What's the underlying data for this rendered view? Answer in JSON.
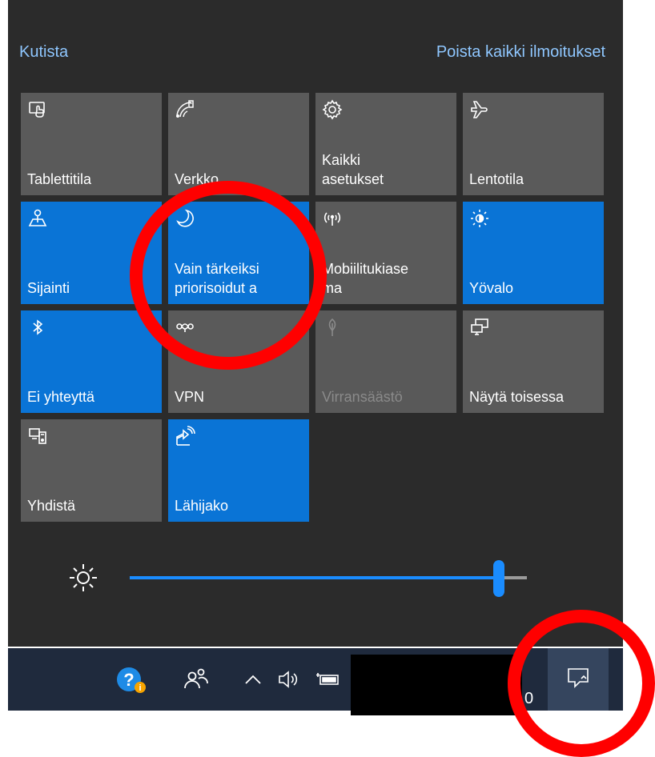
{
  "header": {
    "collapse": "Kutista",
    "clear_all": "Poista kaikki ilmoitukset"
  },
  "tiles": [
    {
      "label": "Tablettitila",
      "icon": "tablet-mode-icon",
      "state": "off"
    },
    {
      "label": "Verkko",
      "icon": "network-icon",
      "state": "off"
    },
    {
      "label": "Kaikki\nasetukset",
      "icon": "gear-icon",
      "state": "off"
    },
    {
      "label": "Lentotila",
      "icon": "airplane-icon",
      "state": "off"
    },
    {
      "label": "Sijainti",
      "icon": "location-icon",
      "state": "on"
    },
    {
      "label": "Vain tärkeiksi\npriorisoidut a",
      "icon": "moon-icon",
      "state": "on"
    },
    {
      "label": "Mobiilitukiase\nma",
      "icon": "hotspot-icon",
      "state": "off"
    },
    {
      "label": "Yövalo",
      "icon": "night-light-icon",
      "state": "on"
    },
    {
      "label": "Ei yhteyttä",
      "icon": "bluetooth-icon",
      "state": "on"
    },
    {
      "label": "VPN",
      "icon": "vpn-icon",
      "state": "off"
    },
    {
      "label": "Virransäästö",
      "icon": "battery-saver-icon",
      "state": "disabled"
    },
    {
      "label": "Näytä toisessa",
      "icon": "project-icon",
      "state": "off"
    },
    {
      "label": "Yhdistä",
      "icon": "connect-icon",
      "state": "off"
    },
    {
      "label": "Lähijako",
      "icon": "nearby-share-icon",
      "state": "on"
    }
  ],
  "brightness": {
    "icon": "brightness-icon",
    "value_percent": 93
  },
  "taskbar": {
    "clock_fragment": "0",
    "icons": [
      "help-icon",
      "people-icon",
      "chevron-up-icon",
      "volume-icon",
      "battery-icon",
      "action-center-icon"
    ]
  },
  "colors": {
    "panel": "#2b2b2b",
    "tile_off": "#5a5a5a",
    "tile_on": "#0a74d6",
    "link": "#8fc7ff",
    "annotation": "#ff0000"
  }
}
